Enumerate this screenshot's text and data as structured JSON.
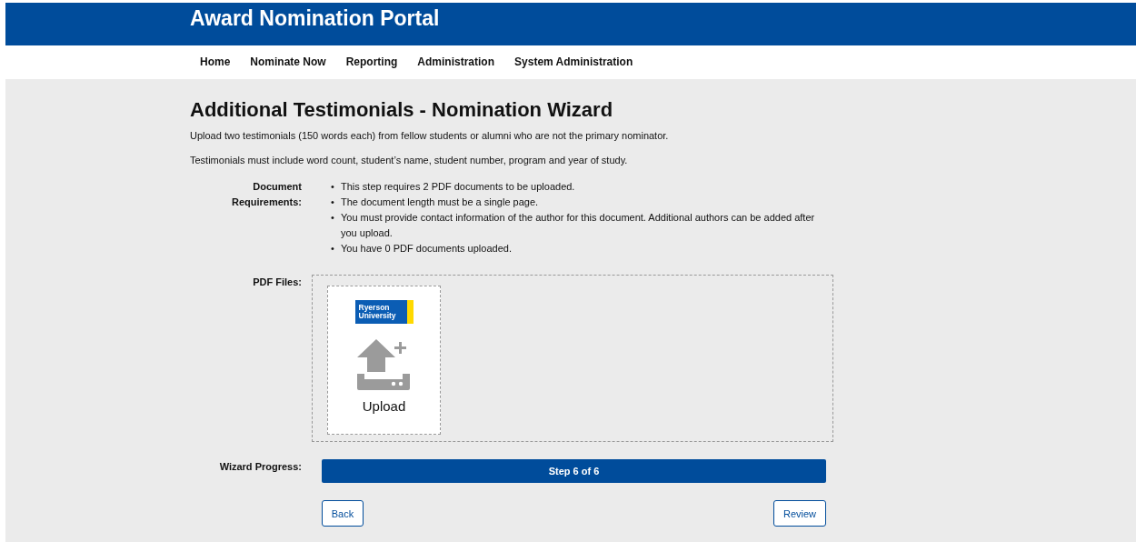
{
  "header": {
    "title": "Award Nomination Portal"
  },
  "nav": [
    {
      "label": "Home"
    },
    {
      "label": "Nominate Now"
    },
    {
      "label": "Reporting"
    },
    {
      "label": "Administration"
    },
    {
      "label": "System Administration"
    }
  ],
  "page": {
    "heading": "Additional Testimonials - Nomination Wizard",
    "intro": [
      "Upload two testimonials (150 words each) from fellow students or alumni who are not the primary nominator.",
      "Testimonials must include word count, student’s name, student number, program and year of study."
    ]
  },
  "requirements": {
    "label": "Document Requirements:",
    "items": [
      {
        "marker": "•",
        "text": "This step requires 2 PDF documents to be uploaded."
      },
      {
        "marker": "•",
        "text": "The document length must be a single page."
      },
      {
        "marker": "•",
        "text": "You must provide contact information of the author for this document. Additional authors can be added after you upload."
      },
      {
        "marker": "•",
        "text": "You have 0 PDF documents uploaded."
      }
    ]
  },
  "pdf_files": {
    "label": "PDF Files:",
    "upload_tile": {
      "logo_text": "Ryerson University",
      "label": "Upload"
    }
  },
  "progress": {
    "label": "Wizard Progress:",
    "text": "Step 6 of 6"
  },
  "buttons": [
    {
      "label": "Back",
      "kind": "back"
    },
    {
      "label": "Review",
      "kind": "next"
    }
  ]
}
